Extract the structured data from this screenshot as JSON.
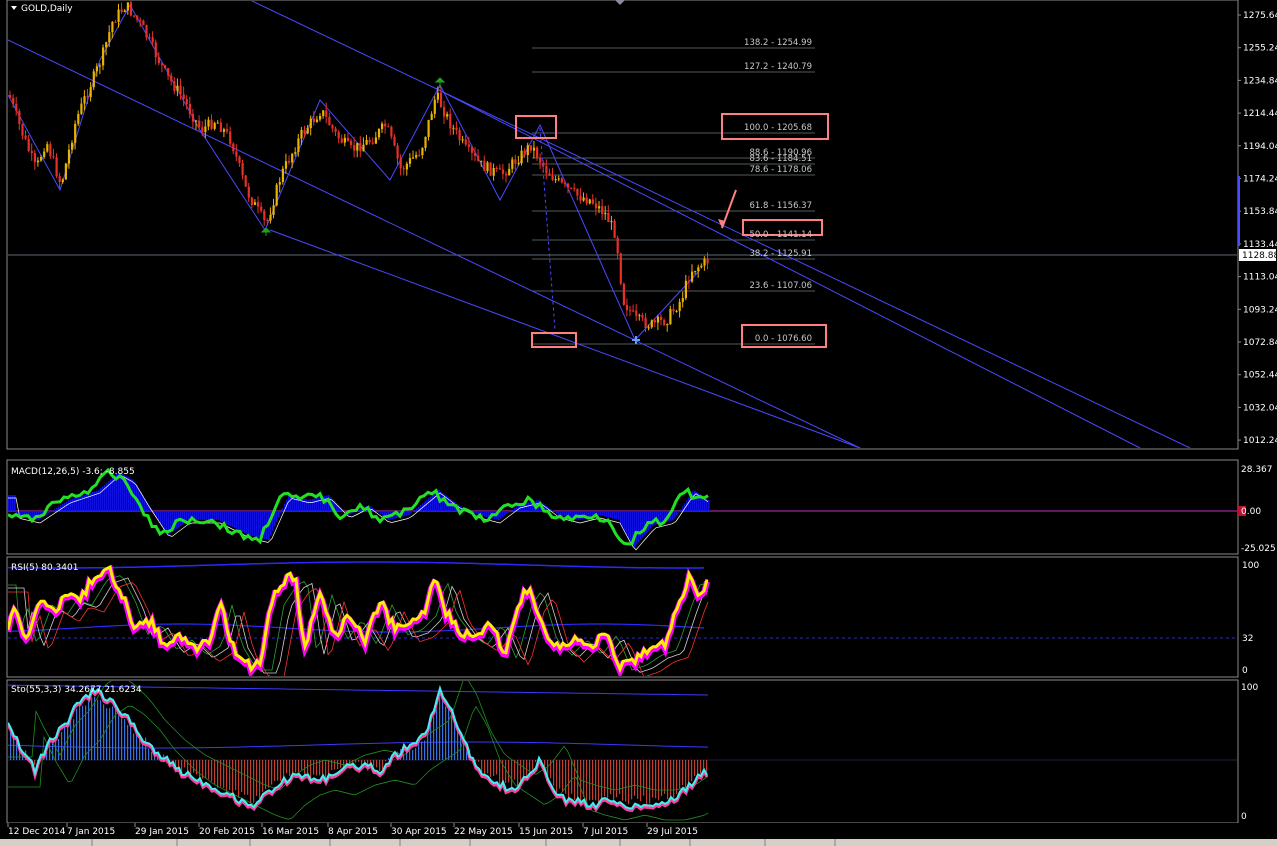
{
  "symbol_title": "GOLD,Daily",
  "price_axis": [
    "1275.64",
    "1255.24",
    "1234.84",
    "1214.44",
    "1194.04",
    "1174.24",
    "1153.84",
    "1133.44",
    "1113.04",
    "1093.24",
    "1072.84",
    "1052.44",
    "1032.04",
    "1012.24"
  ],
  "current_price": "1128.88",
  "fib_levels": [
    {
      "text": "138.2 - 1254.99"
    },
    {
      "text": "127.2 - 1240.79"
    },
    {
      "text": "100.0 - 1205.68"
    },
    {
      "text": "88.6 - 1190.96"
    },
    {
      "text": "83.6 - 1184.51"
    },
    {
      "text": "78.6 - 1178.06"
    },
    {
      "text": "61.8 - 1156.37"
    },
    {
      "text": "50.0 - 1141.14"
    },
    {
      "text": "38.2 - 1125.91"
    },
    {
      "text": "23.6 - 1107.06"
    },
    {
      "text": "0.0 - 1076.60"
    }
  ],
  "macd": {
    "title": "MACD(12,26,5) -3.6; -8.855",
    "axis": [
      "28.367",
      "0.00",
      "-25.025"
    ]
  },
  "rsi": {
    "title": "RSI(5) 80.3401",
    "axis": [
      "100",
      "32",
      "0"
    ]
  },
  "sto": {
    "title": "Sto(55,3,3) 34.2677 21.6234",
    "axis": [
      "100",
      "0"
    ]
  },
  "time_axis": [
    "12 Dec 2014",
    "7 Jan 2015",
    "29 Jan 2015",
    "20 Feb 2015",
    "16 Mar 2015",
    "8 Apr 2015",
    "30 Apr 2015",
    "22 May 2015",
    "15 Jun 2015",
    "7 Jul 2015",
    "29 Jul 2015"
  ],
  "colors": {
    "bull": "#e8b400",
    "bear": "#e8302a",
    "trend": "#4a4aff",
    "highlight": "#ff8080",
    "macd_line": "#22e022",
    "rsi_line": "#ffee00",
    "rsi_shadow": "#ff00ff"
  }
}
